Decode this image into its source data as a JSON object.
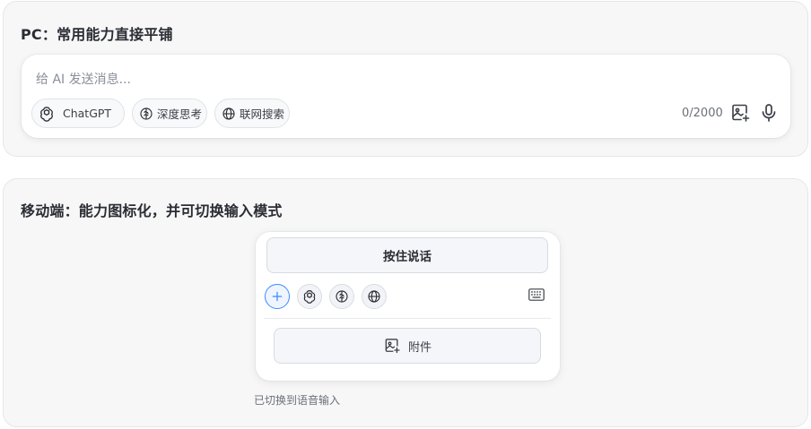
{
  "pc_section": {
    "title": "PC：常用能力直接平铺",
    "composer": {
      "placeholder": "给 AI 发送消息...",
      "chips": {
        "chatgpt": "ChatGPT",
        "deep_think": "深度思考",
        "web_search": "联网搜索"
      },
      "counter": "0/2000",
      "icons": [
        "chatgpt-icon",
        "brain-icon",
        "globe-icon",
        "image-add-icon",
        "microphone-icon"
      ]
    }
  },
  "mobile_section": {
    "title": "移动端：能力图标化，并可切换输入模式",
    "hold_to_talk_label": "按住说话",
    "attachment_label": "附件",
    "switch_note": "已切换到语音输入",
    "icons": [
      "plus-icon",
      "chatgpt-icon",
      "brain-icon",
      "globe-icon",
      "keyboard-icon",
      "image-add-icon"
    ]
  },
  "colors": {
    "accent_blue": "#3d8bfd",
    "panel_bg": "#f7f7f8",
    "card_bg": "#ffffff"
  }
}
